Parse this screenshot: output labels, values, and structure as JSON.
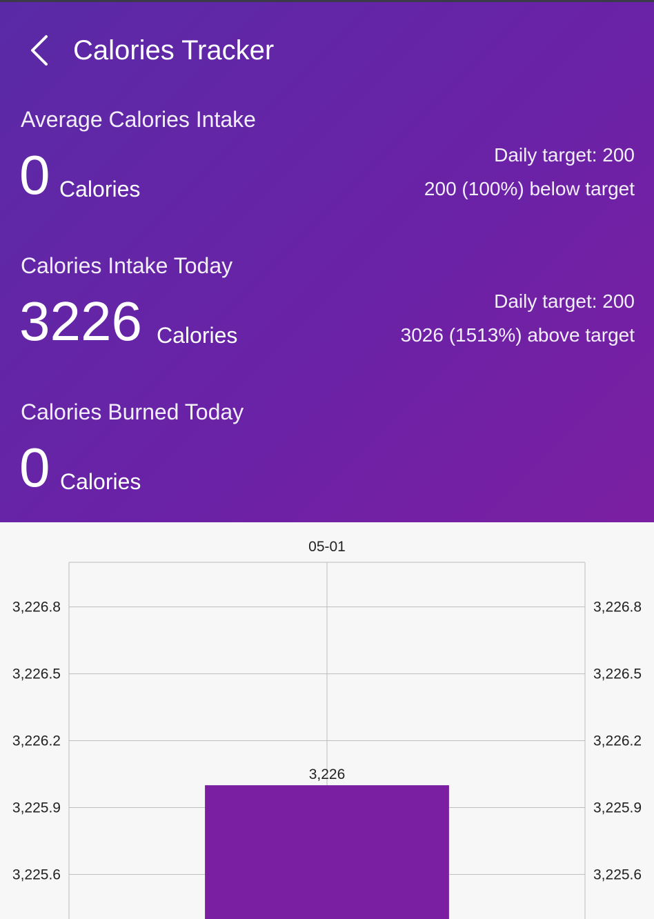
{
  "app": {
    "title": "Calories Tracker"
  },
  "colors": {
    "accent": "#7b1fa2",
    "header_start": "#5a2aa6",
    "header_end": "#7b1fa2"
  },
  "icons": {
    "back": "chevron-left-icon"
  },
  "average": {
    "label": "Average Calories Intake",
    "value": "0",
    "unit": "Calories",
    "target": "Daily target: 200",
    "status": "200 (100%) below target"
  },
  "intake_today": {
    "label": "Calories Intake Today",
    "value": "3226",
    "unit": "Calories",
    "target": "Daily target: 200",
    "status": "3026 (1513%) above target"
  },
  "burned_today": {
    "label": "Calories Burned Today",
    "value": "0",
    "unit": "Calories"
  },
  "chart_data": {
    "type": "bar",
    "categories": [
      "05-01"
    ],
    "values": [
      3226
    ],
    "value_labels": [
      "3,226"
    ],
    "y_ticks": [
      "3,226.8",
      "3,226.5",
      "3,226.2",
      "3,225.9",
      "3,225.6"
    ],
    "y_tick_values": [
      3226.8,
      3226.5,
      3226.2,
      3225.9,
      3225.6
    ],
    "ylim": [
      3225.4,
      3227.0
    ],
    "grid": true,
    "x_axis_position": "top",
    "y_axis": "both sides",
    "bar_color": "#7b1fa2"
  }
}
